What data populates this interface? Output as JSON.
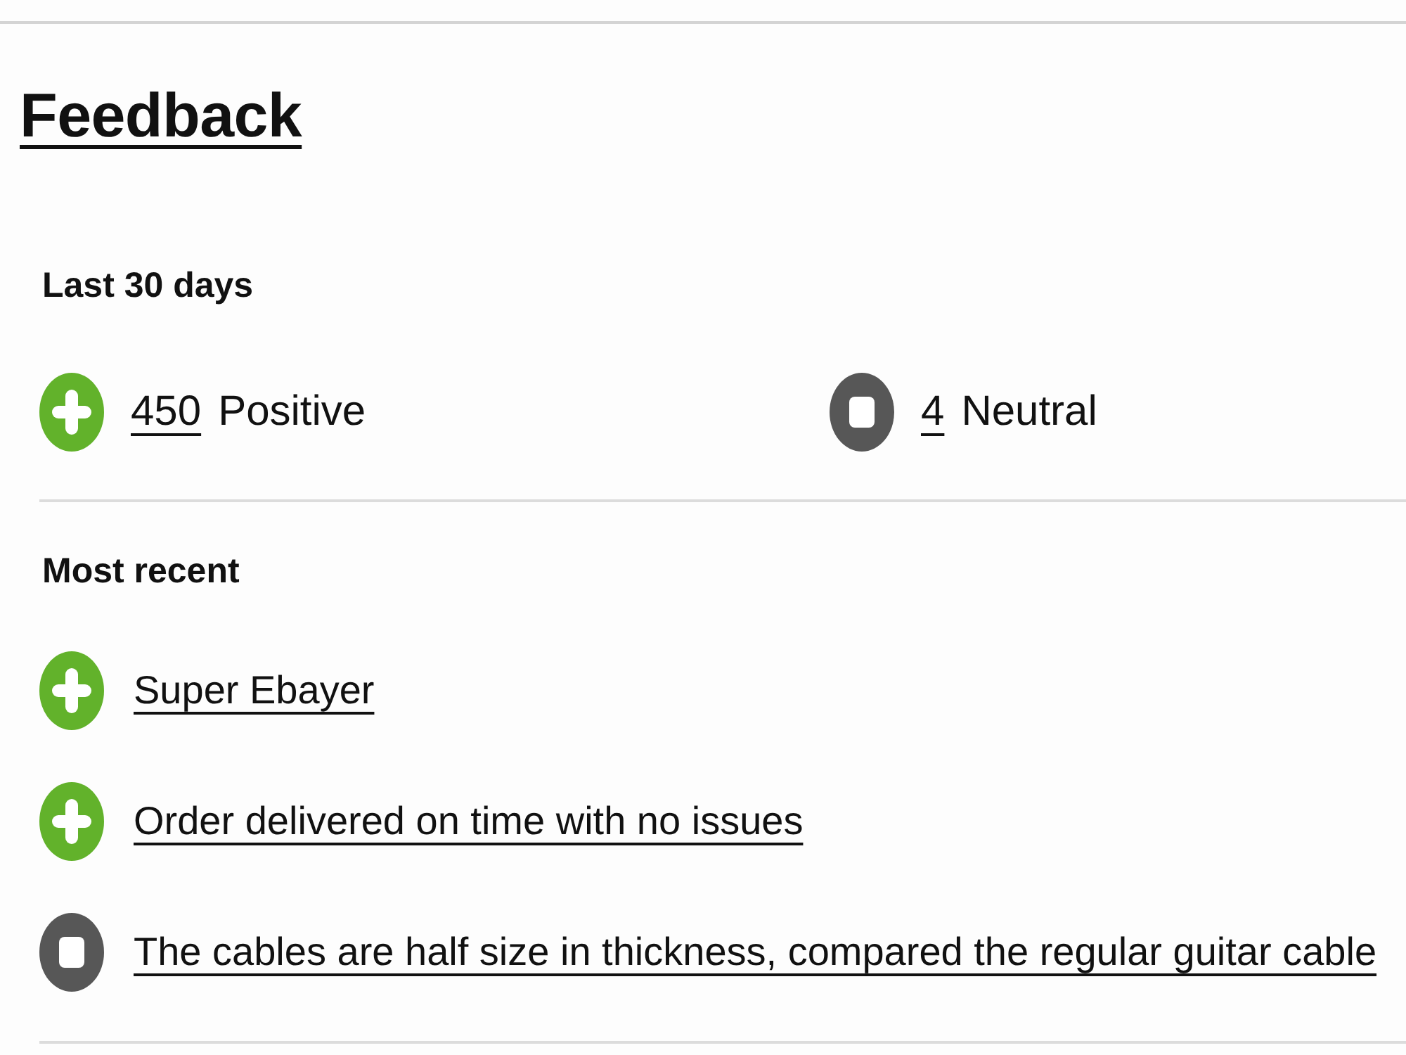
{
  "page": {
    "title": "Feedback"
  },
  "last_30_days": {
    "title": "Last 30 days",
    "ratings": [
      {
        "kind": "positive",
        "count": "450",
        "label": "Positive"
      },
      {
        "kind": "neutral",
        "count": "4",
        "label": "Neutral"
      }
    ]
  },
  "most_recent": {
    "title": "Most recent",
    "items": [
      {
        "kind": "positive",
        "text": "Super Ebayer"
      },
      {
        "kind": "positive",
        "text": "Order delivered on time with no issues"
      },
      {
        "kind": "neutral",
        "text": "The cables are half size in thickness, compared the regular guitar cable"
      }
    ]
  }
}
